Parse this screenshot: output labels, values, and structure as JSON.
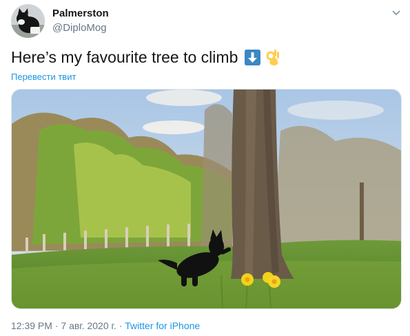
{
  "author": {
    "display_name": "Palmerston",
    "handle": "@DiploMog",
    "avatar_icon": "cat-avatar"
  },
  "tweet": {
    "text": "Here’s my favourite tree to climb",
    "emojis": [
      "down-arrow-emoji",
      "ok-hand-emoji"
    ],
    "translate_label": "Перевести твит"
  },
  "media": {
    "subject": "black cat climbing a tree trunk in a garden with daffodils"
  },
  "meta": {
    "time": "12:39 PM",
    "separator": "·",
    "date": "7 авг. 2020 г.",
    "source": "Twitter for iPhone"
  },
  "colors": {
    "link": "#1b95e0",
    "secondary_text": "#657786",
    "primary_text": "#14171a"
  }
}
